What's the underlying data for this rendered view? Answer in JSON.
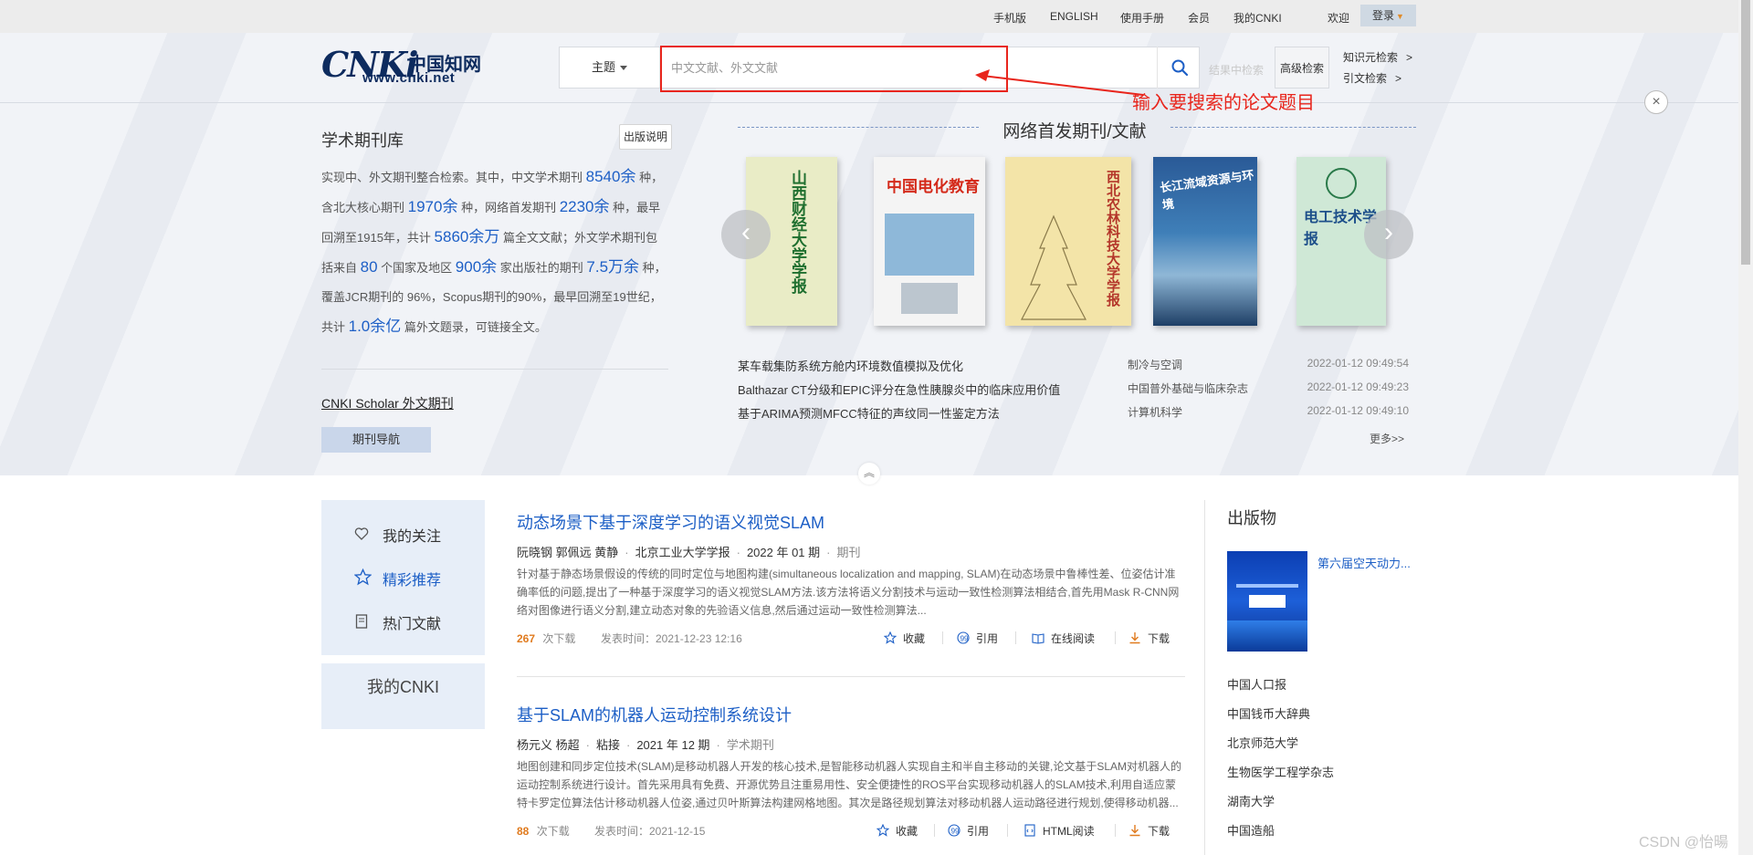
{
  "topbar": {
    "links": [
      "手机版",
      "ENGLISH",
      "使用手册",
      "会员",
      "我的CNKI",
      "欢迎"
    ],
    "login_label": "登录"
  },
  "logo": {
    "brand": "CNKi",
    "chinese": "中国知网",
    "url": "www.cnki.net"
  },
  "search": {
    "scope_label": "主题",
    "placeholder": "中文文献、外文文献",
    "result_search_label": "结果中检索",
    "advanced_label": "高级检索",
    "side_links": [
      {
        "label": "知识元检索",
        "arrow": ">"
      },
      {
        "label": "引文检索",
        "arrow": ">"
      }
    ],
    "annotation": "输入要搜索的论文题目"
  },
  "journal_intro": {
    "title": "学术期刊库",
    "pub_note_label": "出版说明",
    "paragraph": [
      {
        "t": "实现中、外文期刊整合检索。其中，中文学术期刊 "
      },
      {
        "h": "8540余"
      },
      {
        "t": " 种，含北大核心期刊 "
      },
      {
        "h": "1970余"
      },
      {
        "t": " 种，网络首发期刊 "
      },
      {
        "h": "2230余"
      },
      {
        "t": " 种，最早回溯至1915年，共计 "
      },
      {
        "h": "5860余万"
      },
      {
        "t": " 篇全文文献；外文学术期刊包括来自 "
      },
      {
        "h": "80"
      },
      {
        "t": " 个国家及地区 "
      },
      {
        "h": "900余"
      },
      {
        "t": " 家出版社的期刊 "
      },
      {
        "h": "7.5万余"
      },
      {
        "t": " 种，覆盖JCR期刊的 96%，Scopus期刊的90%，最早回溯至19世纪，共计 "
      },
      {
        "h": "1.0余亿"
      },
      {
        "t": " 篇外文题录，可链接全文。"
      }
    ],
    "scholar_link": "CNKI Scholar 外文期刊",
    "nav_button": "期刊导航"
  },
  "first_release": {
    "title": "网络首发期刊/文献",
    "covers": [
      {
        "name": "山西财经大学学报",
        "bg": "#e9ecc6",
        "fg": "#1f6f2f"
      },
      {
        "name": "中国电化教育",
        "bg": "#f4f4f4",
        "fg": "#d42a1a"
      },
      {
        "name": "西北农林科技大学学报",
        "bg": "#f3e4a8",
        "fg": "#b4362a"
      },
      {
        "name": "长江流域资源与环境",
        "bg": "#2d5f9a",
        "fg": "#ffffff"
      },
      {
        "name": "电工技术学报",
        "bg": "#cfe8d6",
        "fg": "#1d4f8a"
      }
    ],
    "news": [
      {
        "title": "某车载集防系统方舱内环境数值模拟及优化",
        "source": "制冷与空调",
        "date": "2022-01-12 09:49:54"
      },
      {
        "title": "Balthazar CT分级和EPIC评分在急性胰腺炎中的临床应用价值",
        "source": "中国普外基础与临床杂志",
        "date": "2022-01-12 09:49:23"
      },
      {
        "title": "基于ARIMA预测MFCC特征的声纹同一性鉴定方法",
        "source": "计算机科学",
        "date": "2022-01-12 09:49:10"
      }
    ],
    "more_label": "更多>>"
  },
  "sidenav": {
    "items": [
      {
        "label": "我的关注",
        "icon": "heart-icon"
      },
      {
        "label": "精彩推荐",
        "icon": "star-icon",
        "active": true
      },
      {
        "label": "热门文献",
        "icon": "document-icon"
      }
    ],
    "mycnki_label": "我的CNKI"
  },
  "articles": [
    {
      "title": "动态场景下基于深度学习的语义视觉SLAM",
      "authors": "阮晓钢 郭佩远 黄静",
      "source": "北京工业大学学报",
      "issue": "2022 年 01 期",
      "type": "期刊",
      "abstract": "针对基于静态场景假设的传统的同时定位与地图构建(simultaneous localization and mapping, SLAM)在动态场景中鲁棒性差、位姿估计准确率低的问题,提出了一种基于深度学习的语义视觉SLAM方法.该方法将语义分割技术与运动一致性检测算法相结合,首先用Mask R-CNN网络对图像进行语义分割,建立动态对象的先验语义信息,然后通过运动一致性检测算法...",
      "downloads": "267",
      "downloads_label": "次下载",
      "published": "发表时间：2021-12-23 12:16",
      "actions": [
        "收藏",
        "引用",
        "在线阅读",
        "下载"
      ]
    },
    {
      "title": "基于SLAM的机器人运动控制系统设计",
      "authors": "杨元义 杨超",
      "source": "粘接",
      "issue": "2021 年 12 期",
      "type": "学术期刊",
      "abstract": "地图创建和同步定位技术(SLAM)是移动机器人开发的核心技术,是智能移动机器人实现自主和半自主移动的关键,论文基于SLAM对机器人的运动控制系统进行设计。首先采用具有免费、开源优势且注重易用性、安全便捷性的ROS平台实现移动机器人的SLAM技术,利用自适应蒙特卡罗定位算法估计移动机器人位姿,通过贝叶斯算法构建网格地图。其次是路径规划算法对移动机器人运动路径进行规划,使得移动机器...",
      "downloads": "88",
      "downloads_label": "次下载",
      "published": "发表时间：2021-12-15",
      "actions": [
        "收藏",
        "引用",
        "HTML阅读",
        "下载"
      ]
    }
  ],
  "publications": {
    "title": "出版物",
    "featured": "第六届空天动力...",
    "items": [
      "中国人口报",
      "中国钱币大辞典",
      "北京师范大学",
      "生物医学工程学杂志",
      "湖南大学",
      "中国造船"
    ]
  },
  "watermark": "CSDN @怡暘",
  "colors": {
    "accent": "#1d5fc6",
    "annotation": "#e8251c",
    "download_count": "#e07b1f"
  }
}
